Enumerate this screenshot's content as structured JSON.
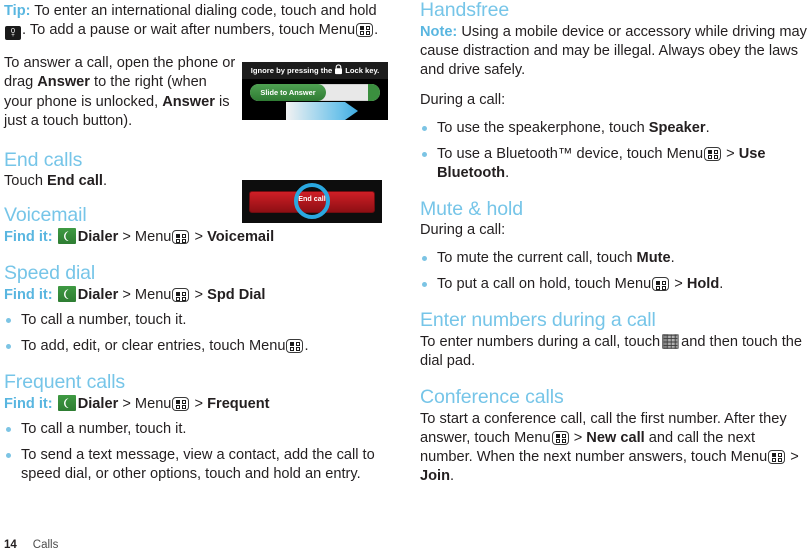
{
  "page": {
    "number": "14",
    "chapter": "Calls"
  },
  "left_column": {
    "tip": {
      "label": "Tip:",
      "text_part1": "To enter an international dialing code, touch and hold",
      "text_part2": ". To add a pause or wait after numbers, touch Menu",
      "text_part3": "."
    },
    "answer_paragraph": {
      "part1": "To answer a call, open the phone or drag ",
      "bold1": "Answer",
      "part2": " to the right (when your phone is unlocked, ",
      "bold2": "Answer",
      "part3": " is just a touch button)."
    },
    "answer_screenshot": {
      "top_bar_prefix": "Ignore by pressing the",
      "top_bar_suffix": "Lock key.",
      "slider_label": "Slide to Answer"
    },
    "end_calls": {
      "heading": "End calls",
      "text_prefix": "Touch ",
      "text_bold": "End call",
      "text_suffix": "."
    },
    "end_call_screenshot": {
      "button_label": "End call"
    },
    "voicemail": {
      "heading": "Voicemail",
      "find_it_label": "Find it:",
      "app": "Dialer",
      "sep1": ">",
      "menu_word": "Menu",
      "sep2": ">",
      "target": "Voicemail"
    },
    "speed_dial": {
      "heading": "Speed dial",
      "find_it_label": "Find it:",
      "app": "Dialer",
      "sep1": ">",
      "menu_word": "Menu",
      "sep2": ">",
      "target": "Spd Dial",
      "bullets": [
        {
          "text": "To call a number, touch it."
        },
        {
          "prefix": "To add, edit, or clear entries, touch Menu",
          "suffix": "."
        }
      ]
    },
    "frequent_calls": {
      "heading": "Frequent calls",
      "find_it_label": "Find it:",
      "app": "Dialer",
      "sep1": ">",
      "menu_word": "Menu",
      "sep2": ">",
      "target": "Frequent",
      "bullets": [
        {
          "text": "To call a number, touch it."
        },
        {
          "text": "To send a text message, view a contact, add the call to speed dial, or other options, touch and hold an entry."
        }
      ]
    }
  },
  "right_column": {
    "handsfree": {
      "heading": "Handsfree",
      "note_label": "Note:",
      "note_text": "Using a mobile device or accessory while driving may cause distraction and may be illegal. Always obey the laws and drive safely.",
      "during_call": "During a call:",
      "bullet1_prefix": "To use the speakerphone, touch ",
      "bullet1_bold": "Speaker",
      "bullet1_suffix": ".",
      "bullet2_prefix": "To use a Bluetooth™ device, touch Menu",
      "bullet2_sep": ">",
      "bullet2_bold": "Use Bluetooth",
      "bullet2_suffix": "."
    },
    "mute_hold": {
      "heading": "Mute & hold",
      "during_call": "During a call:",
      "bullet1_prefix": "To mute the current call, touch ",
      "bullet1_bold": "Mute",
      "bullet1_suffix": ".",
      "bullet2_prefix": "To put a call on hold, touch Menu",
      "bullet2_sep": ">",
      "bullet2_bold": "Hold",
      "bullet2_suffix": "."
    },
    "enter_numbers": {
      "heading": "Enter numbers during a call",
      "text_prefix": "To enter numbers during a call, touch",
      "text_suffix": "and then touch the dial pad."
    },
    "conference": {
      "heading": "Conference calls",
      "text_part1": "To start a conference call, call the first number. After they answer, touch Menu",
      "sep1": ">",
      "bold1": "New call",
      "text_part2": "and call the next number. When the next number answers, touch Menu",
      "sep2": ">",
      "bold2": "Join",
      "text_part3": "."
    }
  },
  "colors": {
    "heading_blue": "#76c5e8",
    "label_blue": "#59b6e0",
    "bullet_blue": "#7cc4e4",
    "dialer_green": "#2f7b33",
    "endcall_red": "#cf1f26",
    "highlight_ring": "#2aa8e0"
  }
}
